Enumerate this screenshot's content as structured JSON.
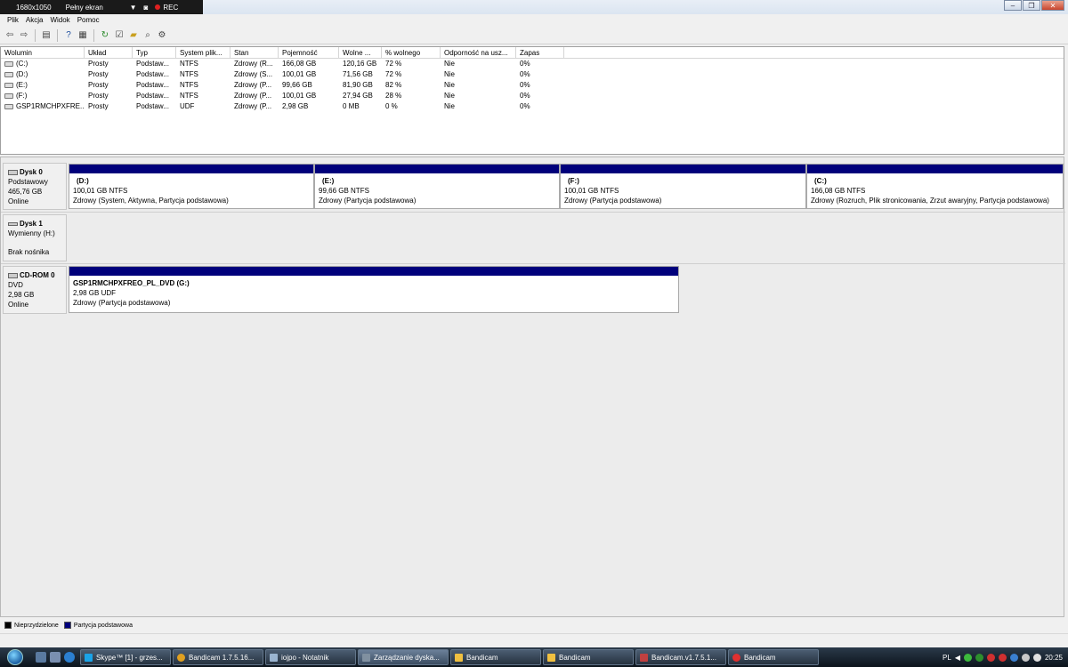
{
  "bandicam": {
    "resolution": "1680x1050",
    "mode": "Pełny ekran",
    "rec_label": "REC"
  },
  "window_controls": {
    "minimize": "–",
    "restore": "❐",
    "close": "✕"
  },
  "menu": [
    "Plik",
    "Akcja",
    "Widok",
    "Pomoc"
  ],
  "volume_table": {
    "headers": [
      "Wolumin",
      "Układ",
      "Typ",
      "System plik...",
      "Stan",
      "Pojemność",
      "Wolne ...",
      "% wolnego",
      "Odporność na usz...",
      "Zapas"
    ],
    "rows": [
      [
        "(C:)",
        "Prosty",
        "Podstaw...",
        "NTFS",
        "Zdrowy (R...",
        "166,08 GB",
        "120,16 GB",
        "72 %",
        "Nie",
        "0%"
      ],
      [
        "(D:)",
        "Prosty",
        "Podstaw...",
        "NTFS",
        "Zdrowy (S...",
        "100,01 GB",
        "71,56 GB",
        "72 %",
        "Nie",
        "0%"
      ],
      [
        "(E:)",
        "Prosty",
        "Podstaw...",
        "NTFS",
        "Zdrowy (P...",
        "99,66 GB",
        "81,90 GB",
        "82 %",
        "Nie",
        "0%"
      ],
      [
        "(F:)",
        "Prosty",
        "Podstaw...",
        "NTFS",
        "Zdrowy (P...",
        "100,01 GB",
        "27,94 GB",
        "28 %",
        "Nie",
        "0%"
      ],
      [
        "GSP1RMCHPXFRE...",
        "Prosty",
        "Podstaw...",
        "UDF",
        "Zdrowy (P...",
        "2,98 GB",
        "0 MB",
        "0 %",
        "Nie",
        "0%"
      ]
    ]
  },
  "disks": {
    "disk0": {
      "name": "Dysk 0",
      "type": "Podstawowy",
      "size": "465,76 GB",
      "status": "Online",
      "partitions": [
        {
          "name": "(D:)",
          "size": "100,01 GB NTFS",
          "status": "Zdrowy (System, Aktywna, Partycja podstawowa)"
        },
        {
          "name": "(E:)",
          "size": "99,66 GB NTFS",
          "status": "Zdrowy (Partycja podstawowa)"
        },
        {
          "name": "(F:)",
          "size": "100,01 GB NTFS",
          "status": "Zdrowy (Partycja podstawowa)"
        },
        {
          "name": "(C:)",
          "size": "166,08 GB NTFS",
          "status": "Zdrowy (Rozruch, Plik stronicowania, Zrzut awaryjny, Partycja podstawowa)"
        }
      ]
    },
    "disk1": {
      "name": "Dysk 1",
      "type": "Wymienny (H:)",
      "status": "Brak nośnika"
    },
    "cdrom0": {
      "name": "CD-ROM 0",
      "type": "DVD",
      "size": "2,98 GB",
      "status": "Online",
      "partition": {
        "name": "GSP1RMCHPXFREO_PL_DVD  (G:)",
        "size": "2,98 GB UDF",
        "status": "Zdrowy (Partycja podstawowa)"
      }
    }
  },
  "legend": {
    "unallocated": "Nieprzydzielone",
    "primary": "Partycja podstawowa",
    "unallocated_color": "#000000",
    "primary_color": "#00007b"
  },
  "taskbar": {
    "tasks": [
      {
        "label": "Skype™ [1] - grzes...",
        "icon_color": "#1aa3e8"
      },
      {
        "label": "Bandicam 1.7.5.16...",
        "icon_color": "#e0a020"
      },
      {
        "label": "iojpo - Notatnik",
        "icon_color": "#9ab4d0"
      },
      {
        "label": "Zarządzanie dyska...",
        "icon_color": "#8090a0"
      },
      {
        "label": "Bandicam",
        "icon_color": "#f0c040"
      },
      {
        "label": "Bandicam",
        "icon_color": "#f0c040"
      },
      {
        "label": "Bandicam.v1.7.5.1...",
        "icon_color": "#c04040"
      },
      {
        "label": "Bandicam",
        "icon_color": "#e03030"
      }
    ],
    "language": "PL",
    "clock": "20:25"
  }
}
